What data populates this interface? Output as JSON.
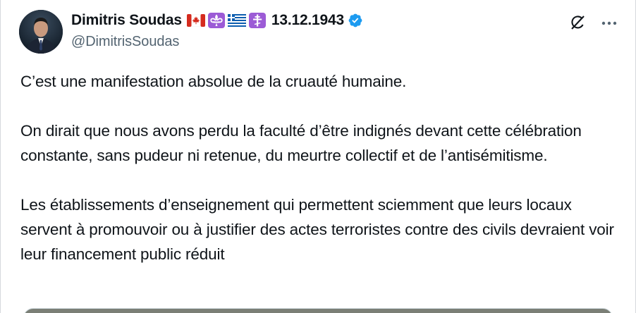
{
  "post": {
    "author_name": "Dimitris Soudas",
    "date_tag": "13.12.1943",
    "handle": "@DimitrisSoudas",
    "paragraphs": [
      "C’est une manifestation absolue de la cruauté humaine.",
      "On dirait que nous avons perdu la faculté d’être indignés devant cette célébration constante, sans pudeur ni retenue, du meurtre collectif et de l’antisémitisme.",
      "Les établissements d’enseignement qui permettent sciemment que leurs locaux servent à promouvoir ou à justifier des actes terroristes contre des civils devraient voir leur financement public réduit"
    ]
  },
  "icons": {
    "flags": [
      "canada-flag-icon",
      "fleur-de-lis-icon",
      "greece-flag-icon",
      "orthodox-cross-icon"
    ],
    "verified": "verified-badge-icon",
    "grok": "grok-icon",
    "more": "more-icon"
  },
  "colors": {
    "text": "#0f1419",
    "secondary": "#536471",
    "verified": "#1d9bf0",
    "emoji_purple": "#9c5bd6",
    "canada_red": "#d52b1e",
    "greece_blue": "#0d5eaf"
  }
}
